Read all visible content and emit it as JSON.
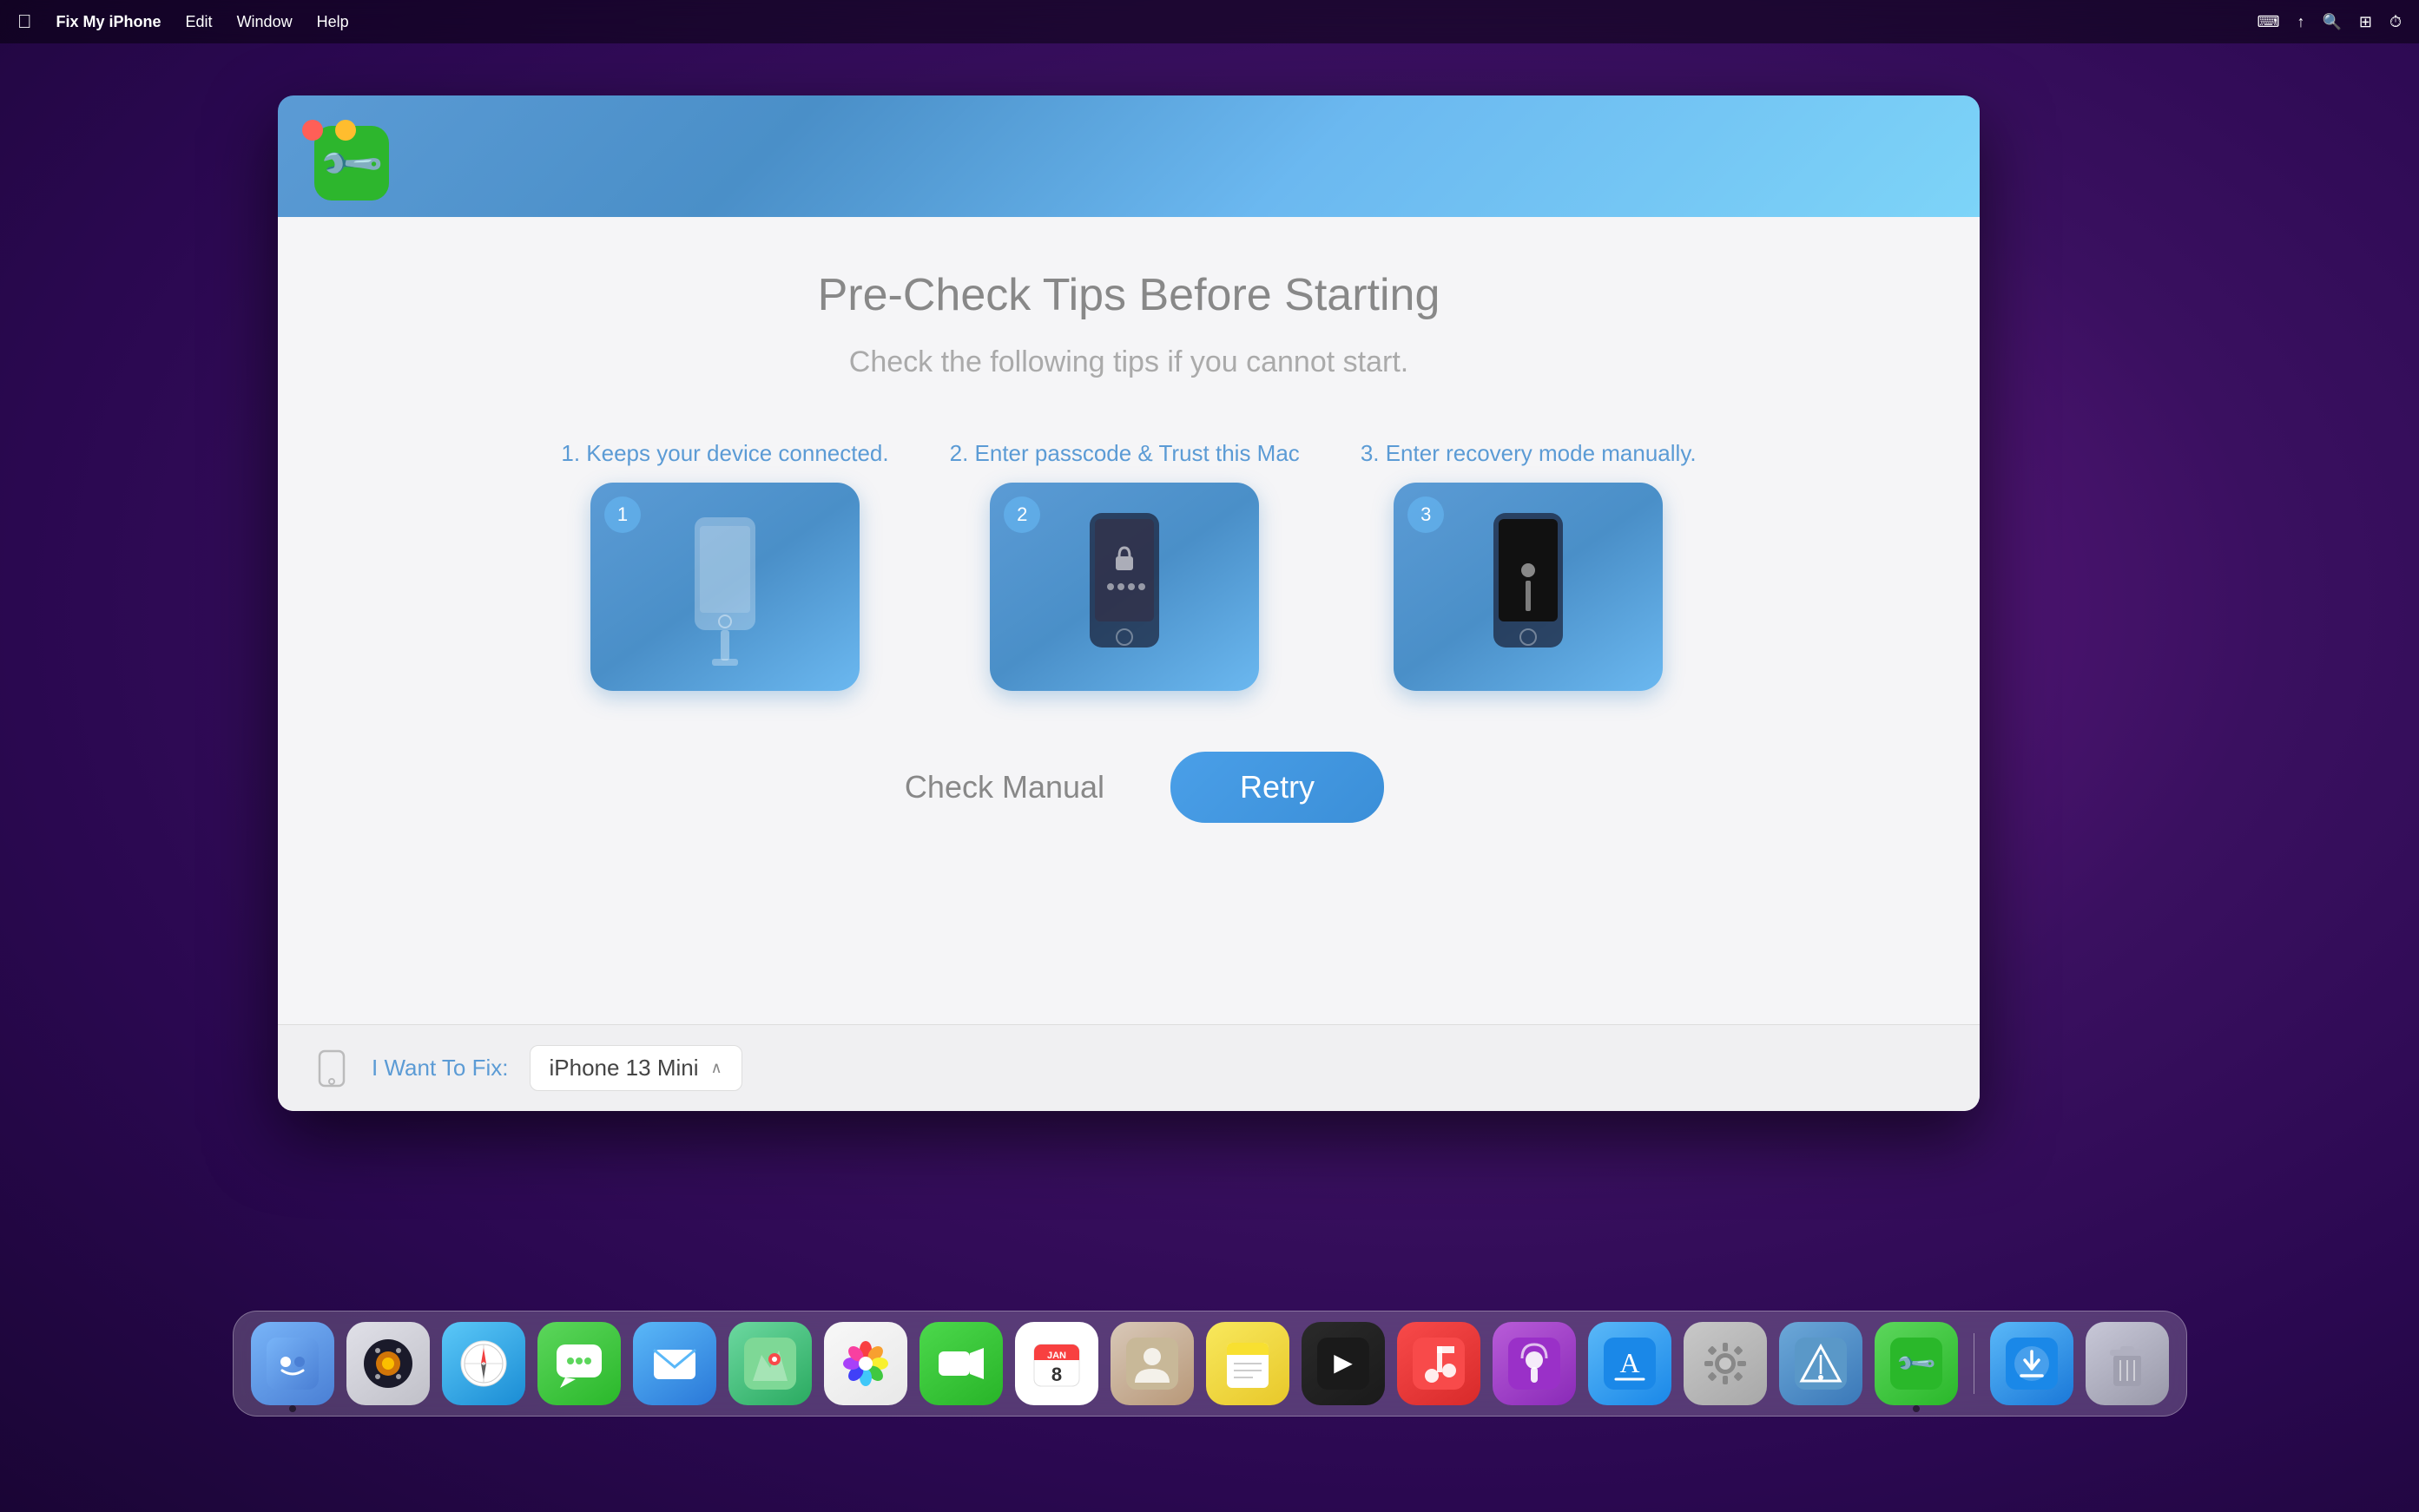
{
  "menubar": {
    "apple_label": "",
    "app_name": "Fix My iPhone",
    "menu_items": [
      "Edit",
      "Window",
      "Help"
    ],
    "right_icons": [
      "keyboard-icon",
      "arrow-up-icon",
      "search-icon",
      "controls-icon",
      "time-icon"
    ]
  },
  "window": {
    "title": "Fix My iPhone",
    "app_logo_symbol": "🔧",
    "main_title": "Pre-Check Tips Before Starting",
    "subtitle": "Check the following tips if you cannot start.",
    "tips": [
      {
        "number": "1",
        "label": "1. Keeps your device connected.",
        "card_type": "connected"
      },
      {
        "number": "2",
        "label": "2. Enter passcode & Trust this Mac",
        "card_type": "passcode"
      },
      {
        "number": "3",
        "label": "3. Enter recovery mode manually.",
        "card_type": "recovery"
      }
    ],
    "check_manual_label": "Check Manual",
    "retry_label": "Retry",
    "bottom_bar": {
      "i_want_to_fix_label": "I Want To Fix:",
      "device_name": "iPhone 13 Mini",
      "dropdown_arrow": "⌃"
    }
  },
  "dock": {
    "items": [
      {
        "name": "finder",
        "emoji": "🔵",
        "label": "Finder",
        "color_class": "dock-finder",
        "has_dot": true
      },
      {
        "name": "launchpad",
        "emoji": "🟠",
        "label": "Launchpad",
        "color_class": "dock-launchpad",
        "has_dot": false
      },
      {
        "name": "safari",
        "emoji": "🧭",
        "label": "Safari",
        "color_class": "dock-safari",
        "has_dot": false
      },
      {
        "name": "messages",
        "emoji": "💬",
        "label": "Messages",
        "color_class": "dock-messages",
        "has_dot": false
      },
      {
        "name": "mail",
        "emoji": "✉️",
        "label": "Mail",
        "color_class": "dock-mail",
        "has_dot": false
      },
      {
        "name": "maps",
        "emoji": "🗺️",
        "label": "Maps",
        "color_class": "dock-maps",
        "has_dot": false
      },
      {
        "name": "photos",
        "emoji": "🌷",
        "label": "Photos",
        "color_class": "dock-photos",
        "has_dot": false
      },
      {
        "name": "facetime",
        "emoji": "📹",
        "label": "FaceTime",
        "color_class": "dock-facetime",
        "has_dot": false
      },
      {
        "name": "calendar",
        "emoji": "📅",
        "label": "Calendar",
        "color_class": "dock-calendar",
        "has_dot": false
      },
      {
        "name": "contacts",
        "emoji": "👤",
        "label": "Contacts",
        "color_class": "dock-contacts",
        "has_dot": false
      },
      {
        "name": "notes",
        "emoji": "📝",
        "label": "Notes",
        "color_class": "dock-notes",
        "has_dot": false
      },
      {
        "name": "appletv",
        "emoji": "📺",
        "label": "Apple TV",
        "color_class": "dock-appletv",
        "has_dot": false
      },
      {
        "name": "music",
        "emoji": "🎵",
        "label": "Music",
        "color_class": "dock-music",
        "has_dot": false
      },
      {
        "name": "podcasts",
        "emoji": "🎙️",
        "label": "Podcasts",
        "color_class": "dock-podcasts",
        "has_dot": false
      },
      {
        "name": "appstore",
        "emoji": "🅰️",
        "label": "App Store",
        "color_class": "dock-appstore",
        "has_dot": false
      },
      {
        "name": "systemprefs",
        "emoji": "⚙️",
        "label": "System Preferences",
        "color_class": "dock-systemprefs",
        "has_dot": false
      },
      {
        "name": "altool",
        "emoji": "📊",
        "label": "Altool",
        "color_class": "dock-altool",
        "has_dot": false
      },
      {
        "name": "fixiphone",
        "emoji": "🔧",
        "label": "Fix My iPhone",
        "color_class": "dock-fixiphone",
        "has_dot": true
      },
      {
        "name": "downloader",
        "emoji": "⬇️",
        "label": "Downloader",
        "color_class": "dock-downloader",
        "has_dot": false
      },
      {
        "name": "trash",
        "emoji": "🗑️",
        "label": "Trash",
        "color_class": "dock-trash",
        "has_dot": false
      }
    ],
    "separator_before": [
      "downloader"
    ]
  }
}
